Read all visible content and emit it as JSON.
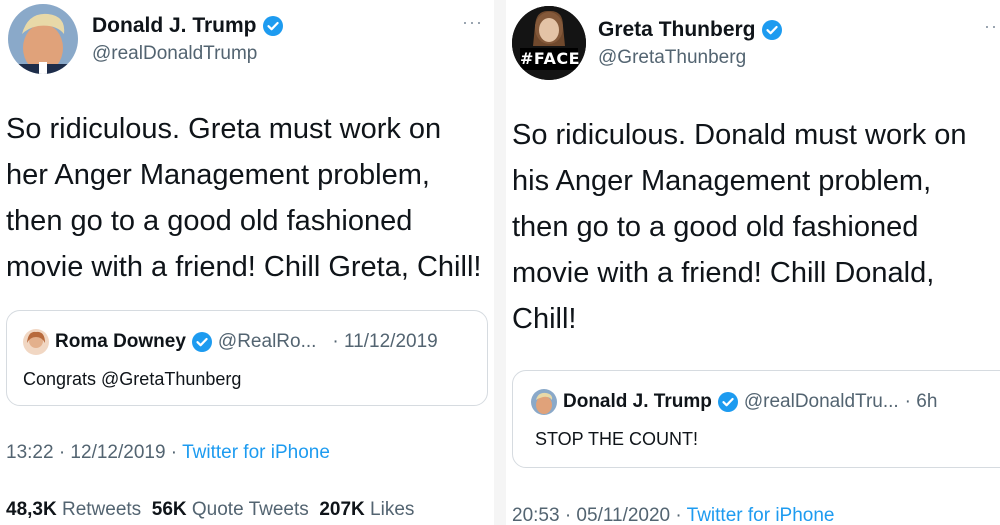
{
  "left": {
    "author": {
      "name": "Donald J. Trump",
      "handle": "@realDonaldTrump",
      "avatar_icon": "trump-avatar"
    },
    "more": "···",
    "text": "So ridiculous. Greta must work on\nher Anger Management problem,\nthen go to a good old fashioned\nmovie with a friend! Chill Greta, Chill!",
    "quote": {
      "name": "Roma Downey",
      "handle": "@RealRo...",
      "date": "· 11/12/2019",
      "text": "Congrats @GretaThunberg"
    },
    "time": "13:22 · 12/12/2019 · ",
    "source": "Twitter for iPhone",
    "stats": {
      "retweets_value": "48,3K",
      "retweets_label": "Retweets",
      "quotes_value": "56K",
      "quotes_label": "Quote Tweets",
      "likes_value": "207K",
      "likes_label": "Likes"
    }
  },
  "right": {
    "author": {
      "name": "Greta Thunberg",
      "handle": "@GretaThunberg",
      "avatar_icon": "face-avatar",
      "avatar_text": "#FACE"
    },
    "more": "··",
    "text": "So ridiculous. Donald must work on\nhis Anger Management problem,\nthen go to a good old fashioned\nmovie with a friend! Chill Donald,\nChill!",
    "quote": {
      "name": "Donald J. Trump",
      "handle": "@realDonaldTru...",
      "date": "· 6h",
      "text": "STOP THE COUNT!"
    },
    "time": "20:53 · 05/11/2020 · ",
    "source": "Twitter for iPhone"
  },
  "colors": {
    "verified": "#1d9bf0",
    "link": "#1d9bf0",
    "secondary": "#536471"
  }
}
